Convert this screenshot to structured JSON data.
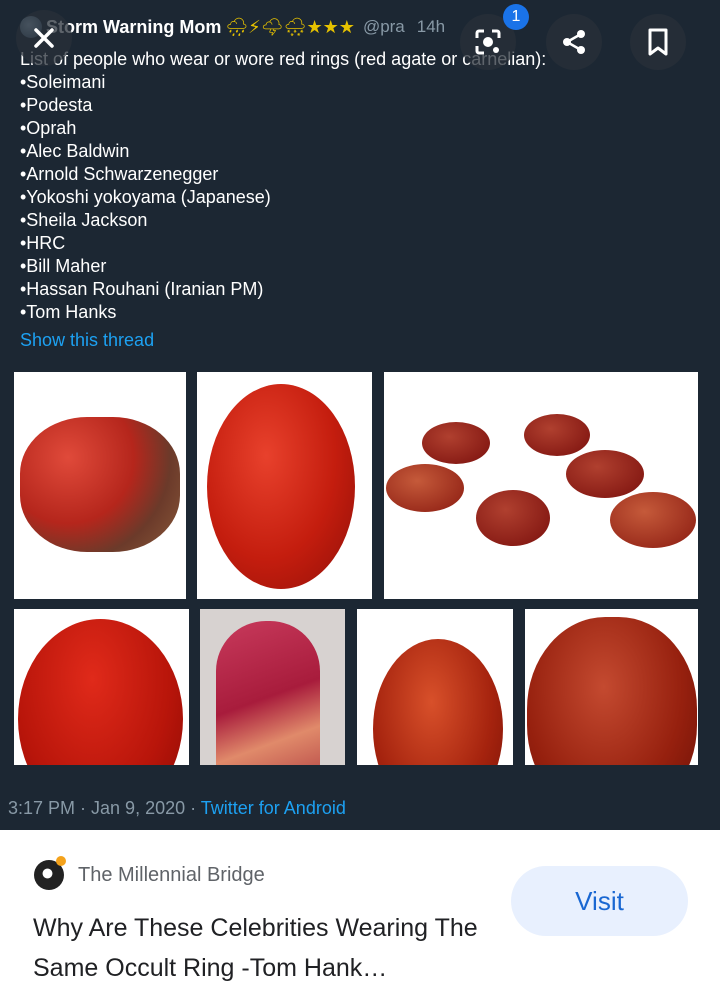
{
  "tweet": {
    "author": "Storm Warning Mom",
    "emojis": "🌧⚡🌩🌨★★★",
    "handle": "@pra",
    "time": "14h",
    "intro": "List of people who wear or wore red rings (red agate or carnelian):",
    "names": [
      "•Soleimani",
      "•Podesta",
      "•Oprah",
      "•Alec Baldwin",
      "•Arnold Schwarzenegger",
      "•Yokoshi yokoyama (Japanese)",
      "•Sheila Jackson",
      "•HRC",
      "•Bill Maher",
      "•Hassan Rouhani (Iranian PM)",
      "•Tom Hanks"
    ],
    "show_thread": "Show this thread",
    "timestamp": "3:17 PM · Jan 9, 2020 · ",
    "source": "Twitter for Android"
  },
  "viewer": {
    "badge_count": "1",
    "icons": [
      "close-icon",
      "lens-icon",
      "share-icon",
      "bookmark-icon"
    ]
  },
  "card": {
    "site_name": "The Millennial Bridge",
    "title": "Why Are These Celebrities Wearing The Same Occult Ring -Tom Hank…",
    "visit_label": "Visit"
  },
  "colors": {
    "viewer_bg": "#1c2733",
    "link_blue": "#1da1f2",
    "visit_bg": "#e8f0fe",
    "visit_text": "#1967d2"
  }
}
